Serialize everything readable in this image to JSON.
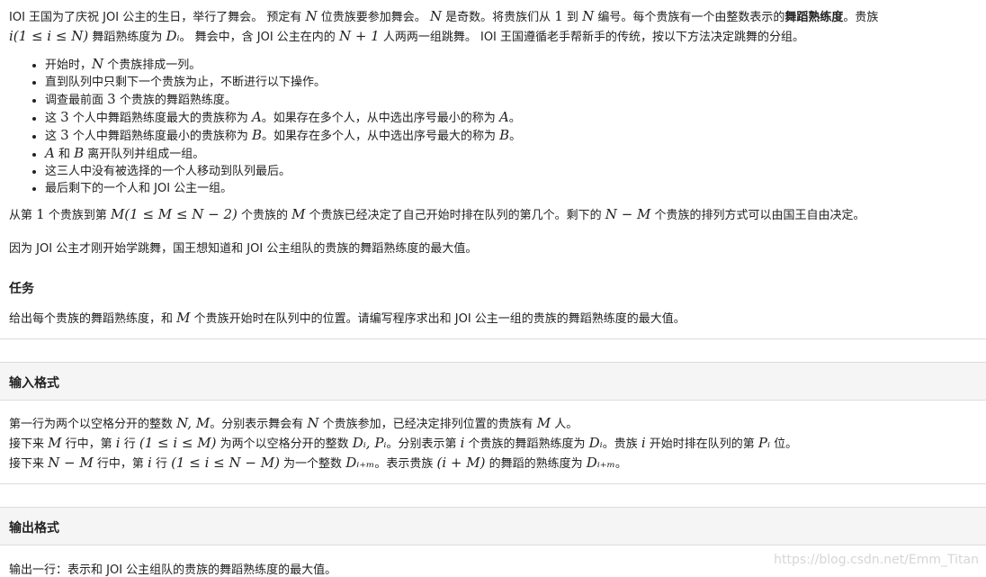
{
  "intro": {
    "l1a": "IOI 王国为了庆祝 JOI 公主的生日，举行了舞会。 预定有 ",
    "l1b": " 位贵族要参加舞会。 ",
    "l1c": " 是奇数。将贵族们从 ",
    "l1d": " 到 ",
    "l1e": " 编号。每个贵族有一个由整数表示的",
    "l1bold": "舞蹈熟练度",
    "l1f": "。贵族",
    "l2a": " 舞蹈熟练度为 ",
    "l2b": "。 舞会中，含 JOI 公主在内的 ",
    "l2c": " 人两两一组跳舞。 IOI 王国遵循老手帮新手的传统，按以下方法决定跳舞的分组。"
  },
  "math": {
    "N": "N",
    "one": "1",
    "M": "M",
    "A": "A",
    "B": "B",
    "three": "3",
    "i_range": "i(1 ≤ i ≤ N)",
    "Di": "Dᵢ",
    "N_plus_1": "N + 1",
    "M_range": "M(1 ≤ M ≤ N − 2)",
    "N_minus_M": "N − M",
    "NM": "N, M",
    "i": "i",
    "range_1_M": "(1 ≤ i ≤ M)",
    "DiPi": "Dᵢ, Pᵢ",
    "Pi": "Pᵢ",
    "range_1_NM": "(1 ≤ i ≤ N − M)",
    "D_iM": "Dᵢ₊ₘ",
    "i_plus_M": "(i + M)"
  },
  "rules": {
    "r1a": "开始时，",
    "r1b": " 个贵族排成一列。",
    "r2": "直到队列中只剩下一个贵族为止，不断进行以下操作。",
    "r3a": "调查最前面 ",
    "r3b": " 个贵族的舞蹈熟练度。",
    "r4a": "这 ",
    "r4b": " 个人中舞蹈熟练度最大的贵族称为 ",
    "r4c": "。如果存在多个人，从中选出序号最小的称为 ",
    "r4d": "。",
    "r5a": "这 ",
    "r5b": " 个人中舞蹈熟练度最小的贵族称为 ",
    "r5c": "。如果存在多个人，从中选出序号最大的称为 ",
    "r5d": "。",
    "r6a": " 和 ",
    "r6b": " 离开队列并组成一组。",
    "r7": "这三人中没有被选择的一个人移动到队列最后。",
    "r8": "最后剩下的一个人和 JOI 公主一组。"
  },
  "para": {
    "p1a": "从第 ",
    "p1b": " 个贵族到第 ",
    "p1c": " 个贵族的 ",
    "p1d": " 个贵族已经决定了自己开始时排在队列的第几个。剩下的 ",
    "p1e": " 个贵族的排列方式可以由国王自由决定。",
    "p2": "因为 JOI 公主才刚开始学跳舞，国王想知道和 JOI 公主组队的贵族的舞蹈熟练度的最大值。"
  },
  "task": {
    "heading": "任务",
    "a": "给出每个贵族的舞蹈熟练度，和 ",
    "b": " 个贵族开始时在队列中的位置。请编写程序求出和 JOI 公主一组的贵族的舞蹈熟练度的最大值。"
  },
  "input": {
    "heading": "输入格式",
    "l1a": "第一行为两个以空格分开的整数 ",
    "l1b": "。分别表示舞会有 ",
    "l1c": " 个贵族参加，已经决定排列位置的贵族有 ",
    "l1d": " 人。",
    "l2a": "接下来 ",
    "l2b": " 行中，第 ",
    "l2c": " 行 ",
    "l2d": " 为两个以空格分开的整数 ",
    "l2e": "。分别表示第 ",
    "l2f": " 个贵族的舞蹈熟练度为 ",
    "l2g": "。贵族 ",
    "l2h": " 开始时排在队列的第 ",
    "l2i": " 位。",
    "l3a": "接下来 ",
    "l3b": " 行中，第 ",
    "l3c": " 行 ",
    "l3d": " 为一个整数 ",
    "l3e": "。表示贵族 ",
    "l3f": " 的舞蹈的熟练度为 ",
    "l3g": "。"
  },
  "output": {
    "heading": "输出格式",
    "text": "输出一行：表示和 JOI 公主组队的贵族的舞蹈熟练度的最大值。"
  },
  "watermark": "https://blog.csdn.net/Emm_Titan"
}
